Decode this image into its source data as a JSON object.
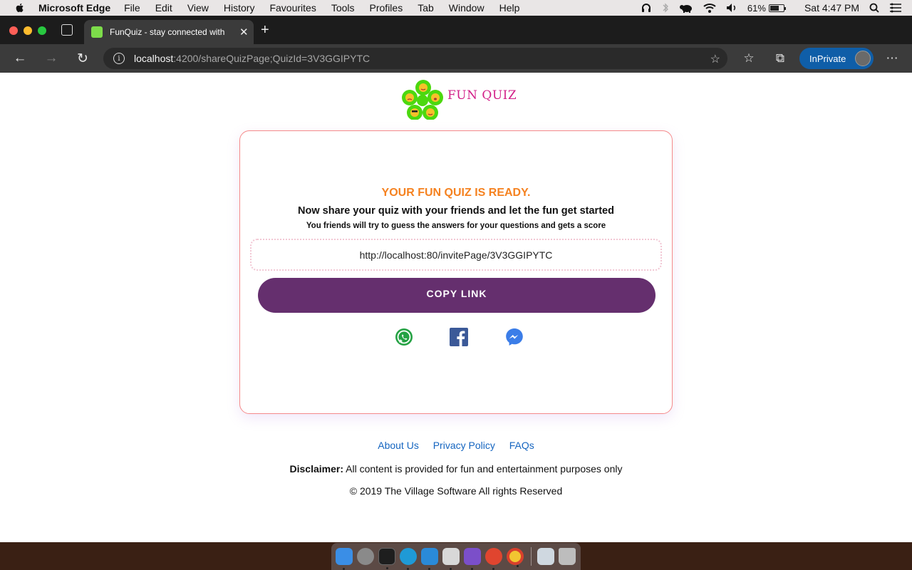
{
  "menubar": {
    "app_name": "Microsoft Edge",
    "items": [
      "File",
      "Edit",
      "View",
      "History",
      "Favourites",
      "Tools",
      "Profiles",
      "Tab",
      "Window",
      "Help"
    ],
    "battery": "61%",
    "clock": "Sat 4:47 PM"
  },
  "browser": {
    "tab_title": "FunQuiz - stay connected with",
    "url_host": "localhost",
    "url_path": ":4200/shareQuizPage;QuizId=3V3GGIPYTC",
    "inprivate_label": "InPrivate"
  },
  "page": {
    "logo_text": "FUN QUIZ",
    "ready_heading": "YOUR FUN QUIZ IS READY.",
    "share_line": "Now share your quiz with your friends and let the fun get started",
    "sub_line": "You friends will try to guess the answers for your questions and gets a score",
    "invite_link": "http://localhost:80/invitePage/3V3GGIPYTC",
    "copy_button": "COPY LINK",
    "share_icons": [
      "whatsapp-icon",
      "facebook-icon",
      "messenger-icon"
    ]
  },
  "footer": {
    "links": [
      "About Us",
      "Privacy Policy",
      "FAQs"
    ],
    "disclaimer_label": "Disclaimer:",
    "disclaimer_text": " All content is provided for fun and entertainment purposes only",
    "copyright": "© 2019 The Village Software All rights Reserved"
  },
  "colors": {
    "accent_orange": "#f58220",
    "button_purple": "#652f6e",
    "logo_pink": "#d21f88",
    "link_blue": "#1565c0",
    "card_border": "#f58a8a"
  },
  "dock": {
    "apps": [
      "finder-icon",
      "launchpad-icon",
      "terminal-icon",
      "edge-icon",
      "vscode-icon",
      "app-icon",
      "visual-studio-icon",
      "remote-desktop-icon",
      "chrome-icon",
      "preview-icon",
      "trash-icon"
    ]
  }
}
